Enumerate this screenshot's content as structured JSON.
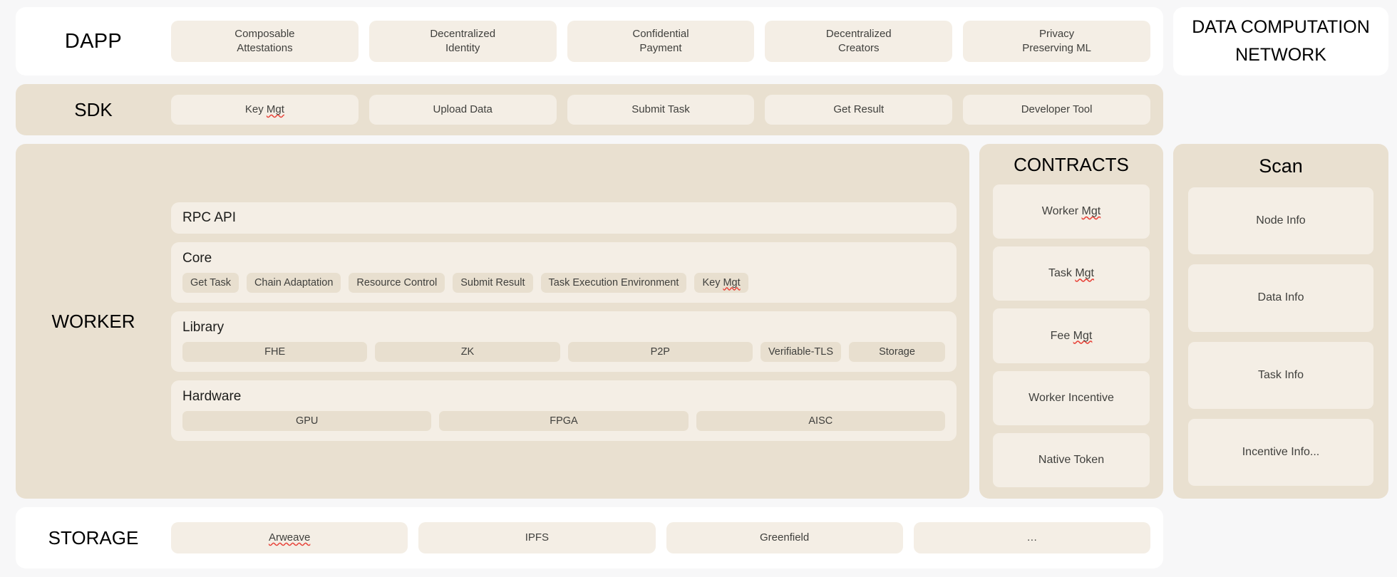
{
  "diagram": {
    "dapp": {
      "label": "DAPP",
      "cards": [
        "Composable\nAttestations",
        "Decentralized\nIdentity",
        "Confidential\nPayment",
        "Decentralized\nCreators",
        "Privacy\nPreserving ML"
      ]
    },
    "network_title": "DATA COMPUTATION\nNETWORK",
    "sdk": {
      "label": "SDK",
      "cards": [
        "Key Mgt",
        "Upload Data",
        "Submit Task",
        "Get Result",
        "Developer Tool"
      ],
      "misspelled": [
        "Mgt"
      ]
    },
    "worker": {
      "label": "WORKER",
      "rpc_api": "RPC API",
      "groups": [
        {
          "title": "Core",
          "items": [
            "Get Task",
            "Chain Adaptation",
            "Resource Control",
            "Submit Result",
            "Task Execution Environment",
            "Key Mgt"
          ]
        },
        {
          "title": "Library",
          "items": [
            "FHE",
            "ZK",
            "P2P",
            "Verifiable-TLS",
            "Storage"
          ]
        },
        {
          "title": "Hardware",
          "items": [
            "GPU",
            "FPGA",
            "AISC"
          ]
        }
      ]
    },
    "contracts": {
      "title": "CONTRACTS",
      "items": [
        "Worker Mgt",
        "Task Mgt",
        "Fee Mgt",
        "Worker Incentive",
        "Native Token"
      ]
    },
    "scan": {
      "title": "Scan",
      "items": [
        "Node Info",
        "Data Info",
        "Task Info",
        "Incentive Info..."
      ]
    },
    "storage": {
      "label": "STORAGE",
      "cards": [
        "Arweave",
        "IPFS",
        "Greenfield",
        "…"
      ]
    },
    "colors": {
      "page_background": "#f7f7f8",
      "band_white": "#ffffff",
      "band_beige": "#e9e0d0",
      "card_beige": "#f4eee5",
      "chip_beige": "#e8dfcf",
      "text": "#40403d",
      "heading": "#000000",
      "spellcheck": "#e8443a"
    }
  }
}
